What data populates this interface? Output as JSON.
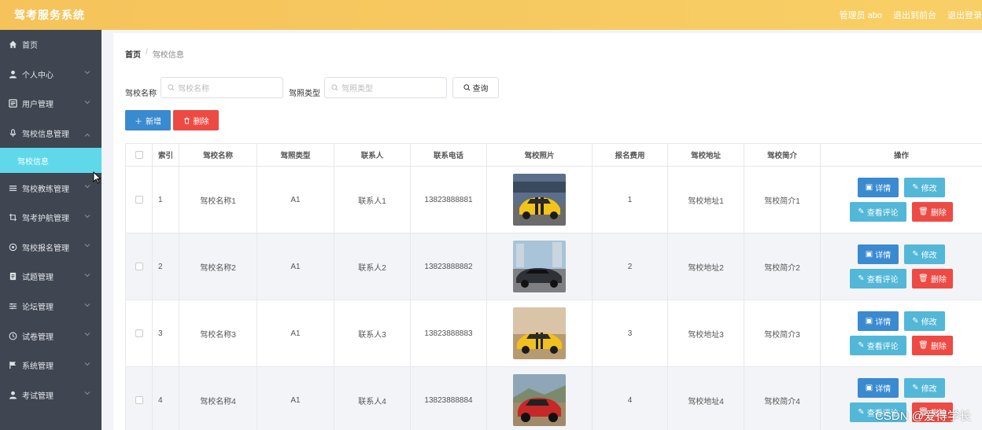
{
  "app": {
    "title": "驾考服务系统"
  },
  "header": {
    "user": "管理员 abo",
    "back_front": "退出到前台",
    "logout": "退出登录"
  },
  "sidebar": {
    "items": [
      {
        "label": "首页",
        "icon": "home-icon",
        "has_children": false
      },
      {
        "label": "个人中心",
        "icon": "user-icon",
        "has_children": true
      },
      {
        "label": "用户管理",
        "icon": "list-icon",
        "has_children": true
      },
      {
        "label": "驾校信息管理",
        "icon": "mic-icon",
        "has_children": true,
        "open": true
      },
      {
        "label": "驾校教练管理",
        "icon": "menu-icon",
        "has_children": true
      },
      {
        "label": "驾考护航管理",
        "icon": "crop-icon",
        "has_children": true
      },
      {
        "label": "驾校报名管理",
        "icon": "target-icon",
        "has_children": true
      },
      {
        "label": "试题管理",
        "icon": "document-icon",
        "has_children": true
      },
      {
        "label": "论坛管理",
        "icon": "sliders-icon",
        "has_children": true
      },
      {
        "label": "试卷管理",
        "icon": "clock-icon",
        "has_children": true
      },
      {
        "label": "系统管理",
        "icon": "flag-icon",
        "has_children": true
      },
      {
        "label": "考试管理",
        "icon": "user-icon",
        "has_children": true
      }
    ],
    "active_sub": "驾校信息"
  },
  "breadcrumb": {
    "home": "首页",
    "separator": "/",
    "current": "驾校信息"
  },
  "search": {
    "name_label": "驾校名称",
    "name_placeholder": "驾校名称",
    "type_label": "驾照类型",
    "type_placeholder": "驾照类型",
    "query_button": "查询"
  },
  "actions": {
    "add": "新增",
    "delete": "删除"
  },
  "table": {
    "headers": [
      "索引",
      "驾校名称",
      "驾照类型",
      "联系人",
      "联系电话",
      "驾校照片",
      "报名费用",
      "驾校地址",
      "驾校简介",
      "操作"
    ],
    "rows": [
      {
        "index": "1",
        "name": "驾校名称1",
        "license": "A1",
        "contact": "联系人1",
        "phone": "13823888881",
        "photo": "yellow-car",
        "fee": "1",
        "address": "驾校地址1",
        "intro": "驾校简介1"
      },
      {
        "index": "2",
        "name": "驾校名称2",
        "license": "A1",
        "contact": "联系人2",
        "phone": "13823888882",
        "photo": "dark-sedan",
        "fee": "2",
        "address": "驾校地址2",
        "intro": "驾校简介2"
      },
      {
        "index": "3",
        "name": "驾校名称3",
        "license": "A1",
        "contact": "联系人3",
        "phone": "13823888883",
        "photo": "yellow-sportscar",
        "fee": "3",
        "address": "驾校地址3",
        "intro": "驾校简介3"
      },
      {
        "index": "4",
        "name": "驾校名称4",
        "license": "A1",
        "contact": "联系人4",
        "phone": "13823888884",
        "photo": "red-suv",
        "fee": "4",
        "address": "驾校地址4",
        "intro": "驾校简介4"
      }
    ],
    "row_buttons": {
      "detail": "详情",
      "edit": "修改",
      "review": "查看评论",
      "delete": "删除"
    }
  },
  "watermark": "CSDN @爱得学长",
  "colors": {
    "header": "#f5c35a",
    "sidebar": "#3f4551",
    "active_sub": "#5fd8ea",
    "primary": "#3a8ad0",
    "info": "#53b7d8",
    "danger": "#ee4a44"
  }
}
